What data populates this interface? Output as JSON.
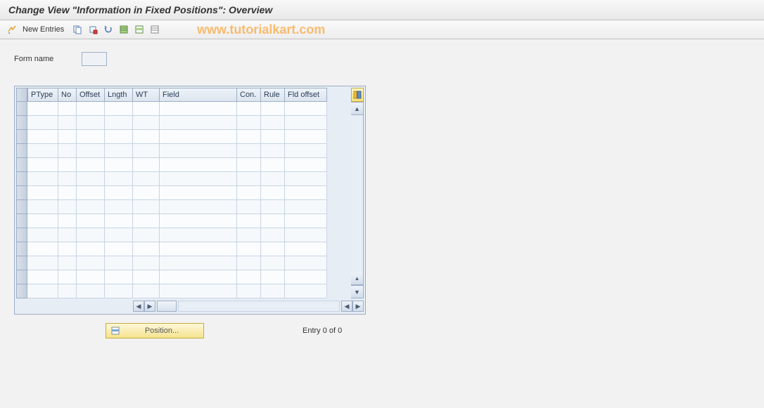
{
  "title": "Change View \"Information in Fixed Positions\": Overview",
  "watermark": "www.tutorialkart.com",
  "toolbar": {
    "new_entries": "New Entries"
  },
  "form": {
    "name_label": "Form name",
    "name_value": ""
  },
  "table": {
    "columns": [
      "PType",
      "No",
      "Offset",
      "Lngth",
      "WT",
      "Field",
      "Con.",
      "Rule",
      "Fld offset"
    ],
    "rows": 14
  },
  "footer": {
    "position_btn": "Position...",
    "entry_text": "Entry 0 of 0"
  },
  "icons": {
    "toggle": "toggle-icon",
    "copy": "copy-icon",
    "save": "save-icon",
    "undo": "undo-icon",
    "select_all": "select-all-icon",
    "select_block": "select-block-icon",
    "deselect": "deselect-icon",
    "config": "config-icon"
  }
}
